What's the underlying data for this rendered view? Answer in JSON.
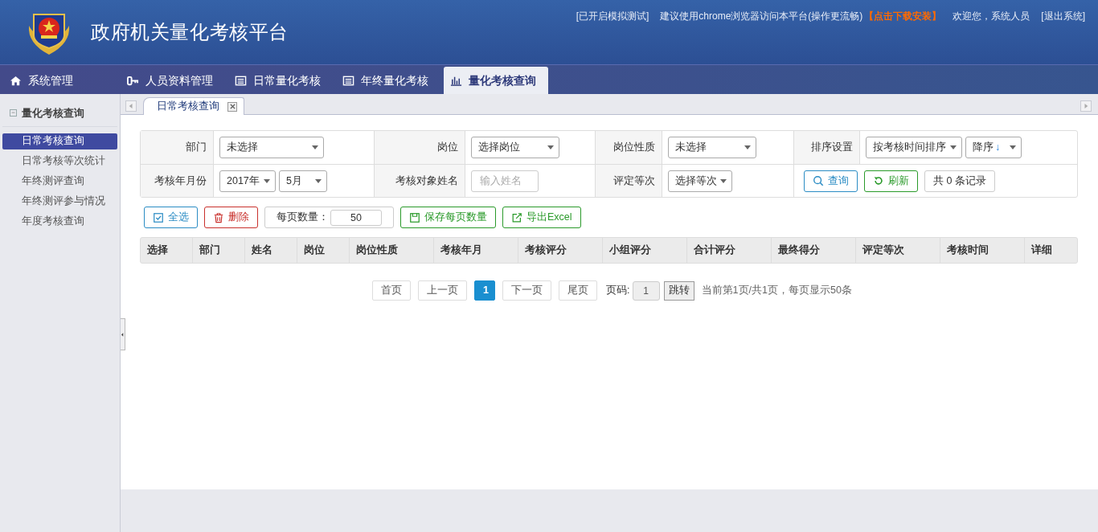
{
  "header": {
    "title": "政府机关量化考核平台",
    "top_links": [
      {
        "text": "[已开启模拟测试]",
        "kind": "text"
      },
      {
        "text": "建议使用chrome浏览器访问本平台(操作更流畅)",
        "kind": "text"
      },
      {
        "text": "【点击下载安装】",
        "kind": "download"
      },
      {
        "text": "欢迎您，系统人员",
        "kind": "text"
      },
      {
        "text": "[退出系统]",
        "kind": "link"
      }
    ]
  },
  "nav_tabs": [
    {
      "label": "系统管理",
      "selected": false
    },
    {
      "label": "人员资料管理",
      "selected": false
    },
    {
      "label": "日常量化考核",
      "selected": false
    },
    {
      "label": "年终量化考核",
      "selected": false
    },
    {
      "label": "量化考核查询",
      "selected": true
    }
  ],
  "sidebar": {
    "title": "量化考核查询",
    "items": [
      {
        "label": "日常考核查询",
        "selected": true
      },
      {
        "label": "日常考核等次统计",
        "selected": false
      },
      {
        "label": "年终测评查询",
        "selected": false
      },
      {
        "label": "年终测评参与情况",
        "selected": false
      },
      {
        "label": "年度考核查询",
        "selected": false
      }
    ]
  },
  "page_tabs": [
    {
      "label": "日常考核查询",
      "selected": true
    }
  ],
  "filters": [
    [
      {
        "label": "部门",
        "controls": [
          {
            "kind": "select",
            "value": "未选择"
          }
        ]
      },
      {
        "label": "岗位",
        "controls": [
          {
            "kind": "select",
            "value": "选择岗位"
          }
        ]
      },
      {
        "label": "岗位性质",
        "controls": [
          {
            "kind": "select",
            "value": "未选择"
          }
        ]
      },
      {
        "label": "排序设置",
        "controls": [
          {
            "kind": "select",
            "value": "按考核时间排序"
          },
          {
            "kind": "select",
            "value": "降序",
            "suffix": "↓"
          }
        ]
      }
    ],
    [
      {
        "label": "考核年月份",
        "controls": [
          {
            "kind": "select",
            "value": "2017年"
          },
          {
            "kind": "select",
            "value": "5月"
          }
        ]
      },
      {
        "label": "考核对象姓名",
        "controls": [
          {
            "kind": "input",
            "placeholder": "输入姓名"
          }
        ]
      },
      {
        "label": "评定等次",
        "controls": [
          {
            "kind": "select",
            "value": "选择等次"
          }
        ]
      },
      {
        "controls": [
          {
            "kind": "button",
            "label": "查询"
          },
          {
            "kind": "button",
            "label": "刷新"
          },
          {
            "kind": "button",
            "label": "共 0 条记录"
          }
        ]
      }
    ]
  ],
  "toolbar": [
    {
      "kind": "button",
      "label": "全选"
    },
    {
      "kind": "button",
      "label": "删除"
    },
    {
      "kind": "number",
      "label": "每页数量：",
      "value": "50"
    },
    {
      "kind": "button",
      "label": "保存每页数量"
    },
    {
      "kind": "button",
      "label": "导出Excel"
    }
  ],
  "table": {
    "columns": [
      "选择",
      "部门",
      "姓名",
      "岗位",
      "岗位性质",
      "考核年月",
      "考核评分",
      "小组评分",
      "合计评分",
      "最终得分",
      "评定等次",
      "考核时间",
      "详细"
    ]
  },
  "pagination": {
    "buttons": [
      {
        "label": "首页",
        "selected": false
      },
      {
        "label": "上一页",
        "selected": false
      },
      {
        "label": "1",
        "selected": true
      },
      {
        "label": "下一页",
        "selected": false
      },
      {
        "label": "尾页",
        "selected": false
      }
    ],
    "page_label": "页码:",
    "page_value": "1",
    "go": "跳转",
    "info": "当前第1页/共1页，每页显示50条"
  }
}
